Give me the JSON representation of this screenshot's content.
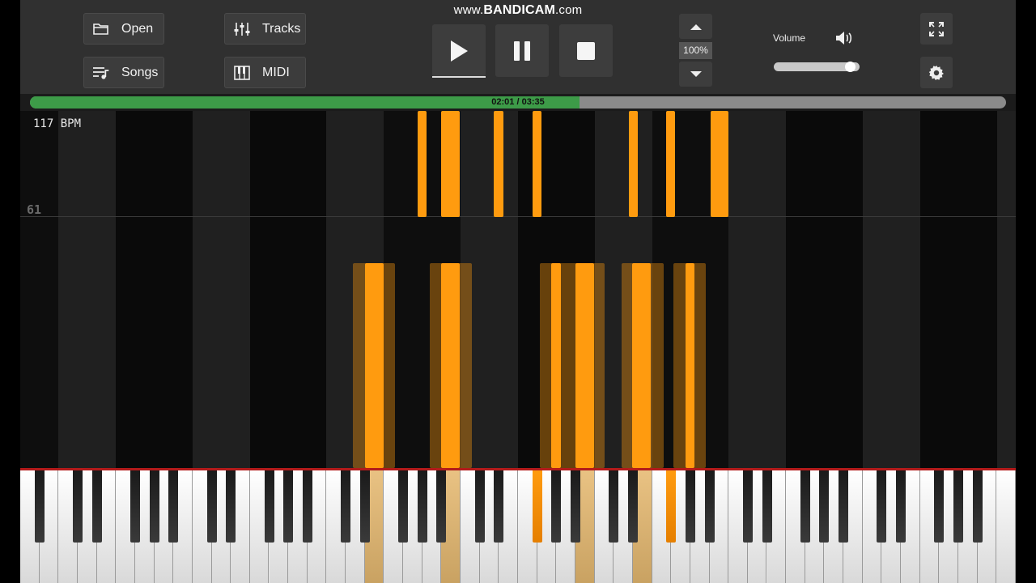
{
  "watermark": {
    "prefix": "www.",
    "brand": "BANDICAM",
    "suffix": ".com"
  },
  "toolbar": {
    "open_label": "Open",
    "songs_label": "Songs",
    "tracks_label": "Tracks",
    "midi_label": "MIDI",
    "speed": "100%",
    "volume_label": "Volume",
    "volume_level": 0.95
  },
  "progress": {
    "text": "02:01 / 03:35",
    "fraction": 0.563
  },
  "roll": {
    "bpm": "117 BPM",
    "measure": "61"
  },
  "keyboard": {
    "pressed_white_keys": [
      18,
      22,
      29,
      32
    ],
    "pressed_black_keys": [
      18,
      23
    ]
  },
  "colors": {
    "note": "#ff9b0f",
    "progress": "#3d9b48",
    "keyboard_edge": "#b31a1a"
  }
}
